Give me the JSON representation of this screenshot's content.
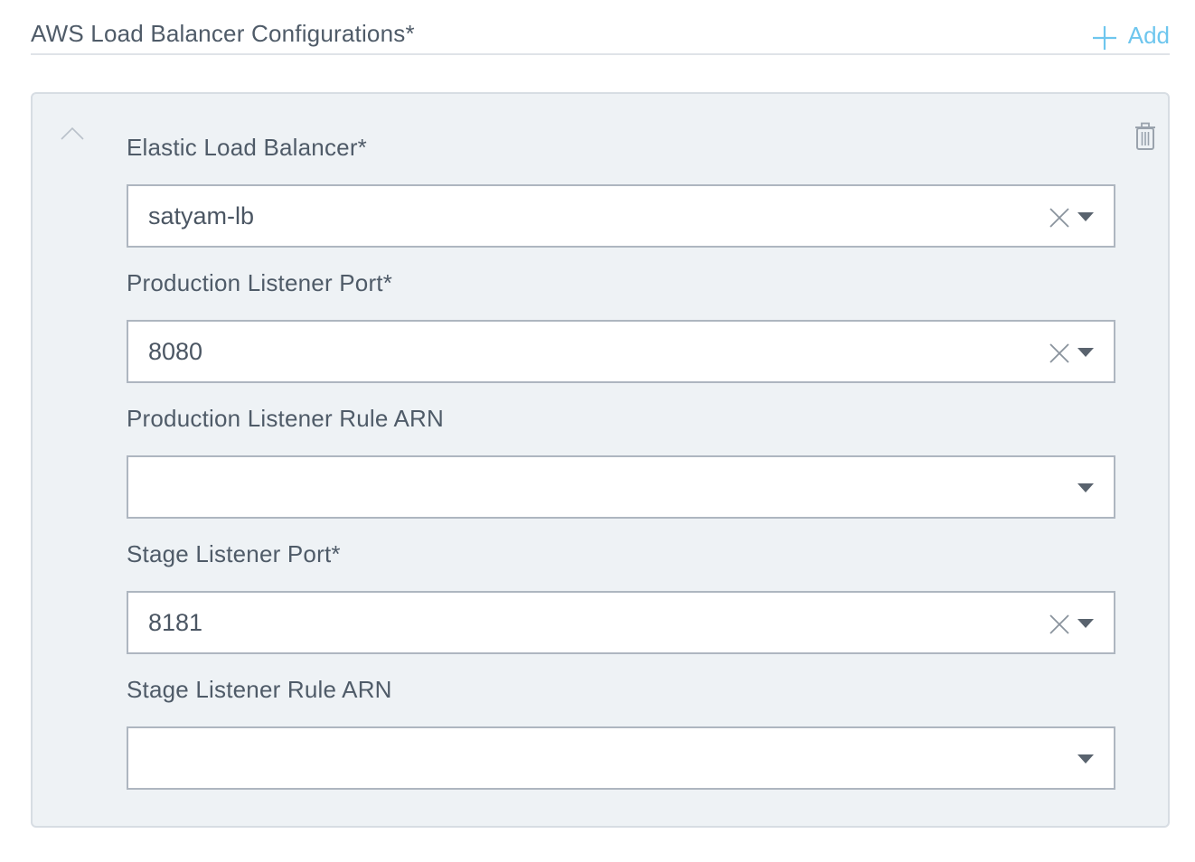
{
  "section": {
    "title": "AWS Load Balancer Configurations*",
    "add_label": "Add"
  },
  "fields": [
    {
      "label": "Elastic Load Balancer*",
      "value": "satyam-lb",
      "clearable": true
    },
    {
      "label": "Production Listener Port*",
      "value": "8080",
      "clearable": true
    },
    {
      "label": "Production Listener Rule ARN",
      "value": "",
      "clearable": false
    },
    {
      "label": "Stage Listener Port*",
      "value": "8181",
      "clearable": true
    },
    {
      "label": "Stage Listener Rule ARN",
      "value": "",
      "clearable": false
    }
  ],
  "icons": {
    "add": "plus-icon",
    "collapse": "chevron-up-icon",
    "delete": "trash-icon",
    "clear": "close-icon",
    "dropdown": "caret-down-icon"
  },
  "colors": {
    "accent": "#6ec6ee",
    "text": "#4f5b68",
    "card_bg": "#eef2f5",
    "input_border": "#aeb6c0",
    "icon_gray": "#8a939d"
  }
}
